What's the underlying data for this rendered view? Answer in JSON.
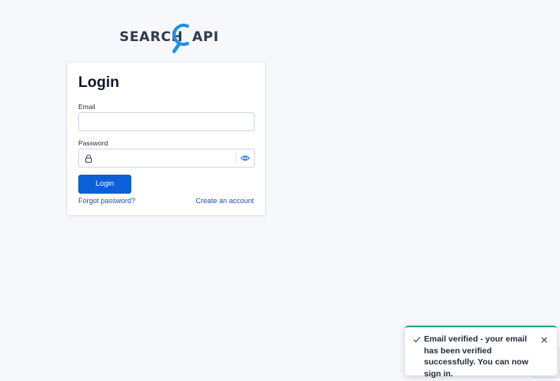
{
  "logo": {
    "left_text": "SEARCH",
    "right_text": "API",
    "accent_color": "#1f8fe6"
  },
  "login": {
    "title": "Login",
    "email_label": "Email",
    "email_value": "",
    "password_label": "Password",
    "password_value": "",
    "button_label": "Login",
    "forgot_link": "Forgot password?",
    "create_link": "Create an account"
  },
  "toast": {
    "message": "Email verified - your email has been verified successfully. You can now sign in.",
    "accent_color": "#20a17f",
    "icon": "check-icon",
    "close_icon": "close-icon"
  },
  "colors": {
    "primary": "#0b5fd7",
    "link": "#1e4fa8",
    "background": "#f6f8fb"
  }
}
